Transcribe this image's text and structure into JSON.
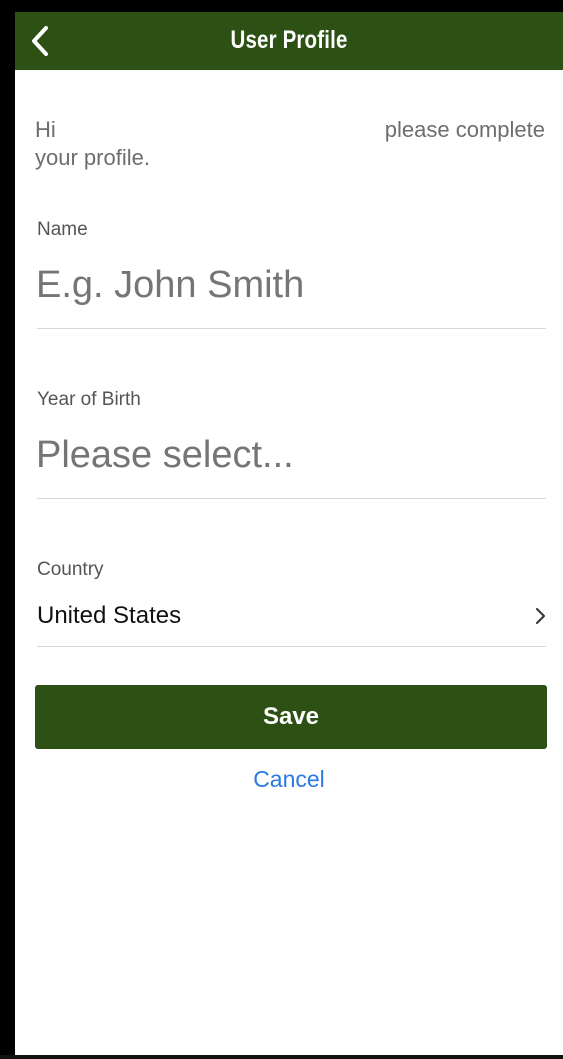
{
  "header": {
    "title": "User Profile",
    "back_icon": "chevron-left-icon",
    "background_color": "#2d5115"
  },
  "greeting": {
    "hi": "Hi",
    "line1_right": "please complete",
    "line2": "your profile."
  },
  "form": {
    "name": {
      "label": "Name",
      "placeholder": "E.g. John Smith",
      "value": ""
    },
    "year_of_birth": {
      "label": "Year of Birth",
      "placeholder": "Please select...",
      "value": ""
    },
    "country": {
      "label": "Country",
      "value": "United States",
      "chevron": "›"
    }
  },
  "actions": {
    "save_label": "Save",
    "cancel_label": "Cancel",
    "save_color": "#2d5115",
    "cancel_color": "#2a7ae2"
  }
}
